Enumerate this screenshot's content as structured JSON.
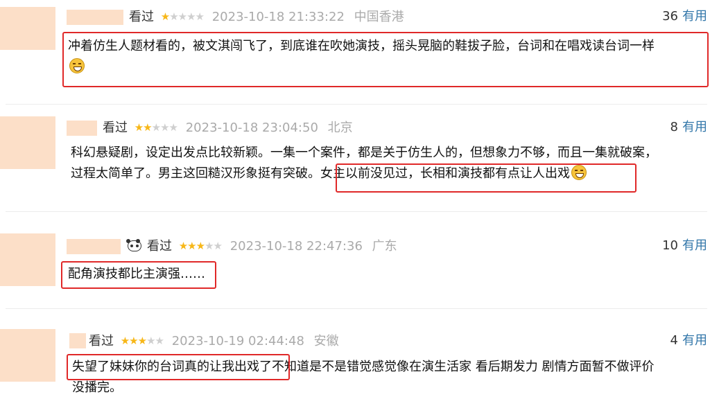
{
  "reviews": [
    {
      "status": "看过",
      "stars_filled": 1,
      "date": "2023-10-18 21:33:22",
      "location": "中国香港",
      "useful_count": "36",
      "useful_label": "有用",
      "text_line1": "冲着仿生人题材看的，被文淇闯飞了，到底谁在吹她演技，摇头晃脑的鞋拔子脸，台词和在唱戏读台词一样"
    },
    {
      "status": "看过",
      "stars_filled": 2,
      "date": "2023-10-18 23:04:50",
      "location": "北京",
      "useful_count": "8",
      "useful_label": "有用",
      "text_line1": "科幻悬疑剧，设定出发点比较新颖。一集一个案件，都是关于仿生人的，但想象力不够，而且一集就破案，",
      "text_line2_plain": "过程太简单了。男主这回糙汉形象挺有突破。",
      "text_line2_highlight": "女主以前没见过，长相和演技都有点让人出戏"
    },
    {
      "status": "看过",
      "stars_filled": 3,
      "date": "2023-10-18 22:47:36",
      "location": "广东",
      "useful_count": "10",
      "useful_label": "有用",
      "text_line1": "配角演技都比主演强……"
    },
    {
      "status": "看过",
      "stars_filled": 3,
      "date": "2023-10-19 02:44:48",
      "location": "安徽",
      "useful_count": "4",
      "useful_label": "有用",
      "text_line1_highlight": "失望了妹妹你的台词真的让我出戏了",
      "text_line1_plain": "不知道是不是错觉感觉像在演生活家 看后期发力 剧情方面暂不做评价",
      "text_line2": "没播完。"
    }
  ],
  "icons": {
    "star_filled": "★",
    "star_empty": "★",
    "emoji": "grinning-sweat-emoji",
    "panda": "panda-icon"
  },
  "colors": {
    "highlight_border": "#e02828",
    "star": "#f7b718",
    "useful_link": "#3377aa",
    "placeholder": "#fcdfc8"
  }
}
